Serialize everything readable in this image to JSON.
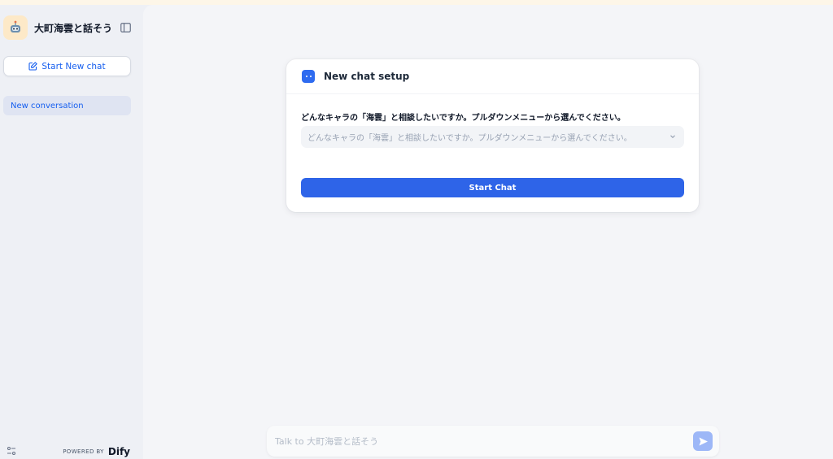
{
  "app": {
    "name": "大町海雲と話そう",
    "icon": "robot-icon"
  },
  "sidebar": {
    "new_chat_label": "Start New chat",
    "conversations": [
      {
        "label": "New conversation",
        "active": true
      }
    ],
    "powered_by": "POWERED BY",
    "brand": "Dify"
  },
  "setup": {
    "title": "New chat setup",
    "field_label": "どんなキャラの「海雲」と相談したいですか。プルダウンメニューから選んでください。",
    "select_placeholder": "どんなキャラの「海雲」と相談したいですか。プルダウンメニューから選んでください。",
    "start_label": "Start Chat"
  },
  "chat": {
    "placeholder": "Talk to 大町海雲と話そう"
  },
  "colors": {
    "accent": "#155eef",
    "button": "#2e64e8",
    "sidebar_bg": "#eef0f5",
    "main_bg": "#f4f5f8"
  }
}
